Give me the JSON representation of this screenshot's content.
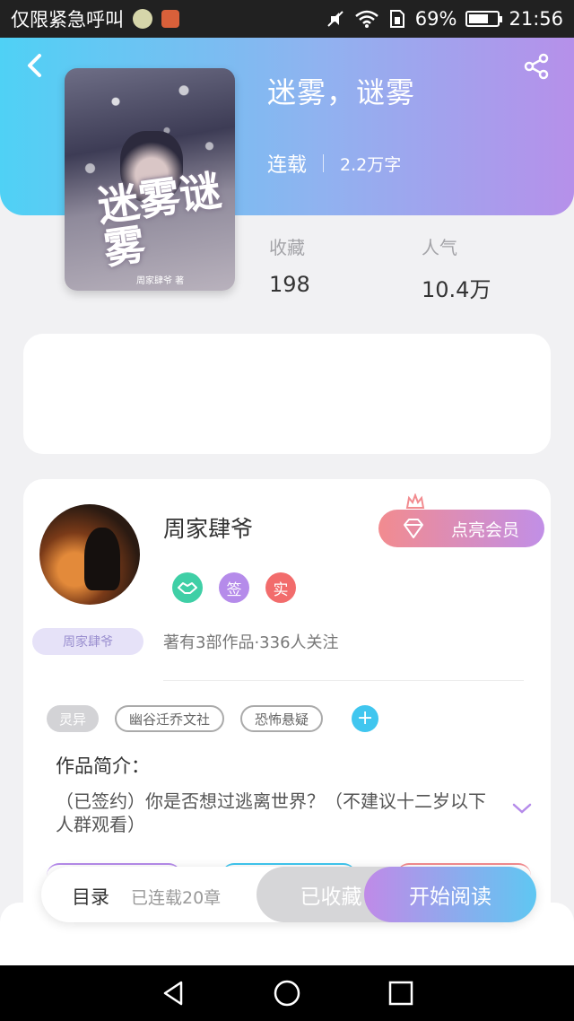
{
  "status_bar": {
    "carrier": "仅限紧急呼叫",
    "battery": "69%",
    "battery_level": 0.69,
    "time": "21:56"
  },
  "header": {
    "back_icon": "chevron-left-icon",
    "share_icon": "share-icon"
  },
  "book": {
    "cover_title": "迷雾谜雾",
    "cover_author": "周家肆爷 著",
    "title": "迷雾，谜雾",
    "status": "连载",
    "words": "2.2万字",
    "stats": [
      {
        "label": "收藏",
        "value": "198"
      },
      {
        "label": "人气",
        "value": "10.4万"
      }
    ]
  },
  "author": {
    "name": "周家肆爷",
    "vip_label": "点亮会员",
    "badges": [
      {
        "icon": "handshake-icon",
        "text": ""
      },
      {
        "icon": "",
        "text": "签"
      },
      {
        "icon": "",
        "text": "实"
      }
    ],
    "name_tag": "周家肆爷",
    "stats_text": "著有3部作品·336人关注",
    "colors": {
      "hand": "#3fcfa6",
      "sign": "#b58bea",
      "real": "#f26c6c"
    }
  },
  "tags": [
    "灵异",
    "幽谷迁乔文社",
    "恐怖悬疑"
  ],
  "intro": {
    "label": "作品简介：",
    "text": "（已签约）你是否想过逃离世界？（不建议十二岁以下人群观看）"
  },
  "action_bar": {
    "toc": "目录",
    "chapters": "已连载20章",
    "collected": "已收藏",
    "read": "开始阅读"
  },
  "nav": {
    "back": "triangle-back-icon",
    "home": "circle-home-icon",
    "recent": "square-recent-icon"
  }
}
